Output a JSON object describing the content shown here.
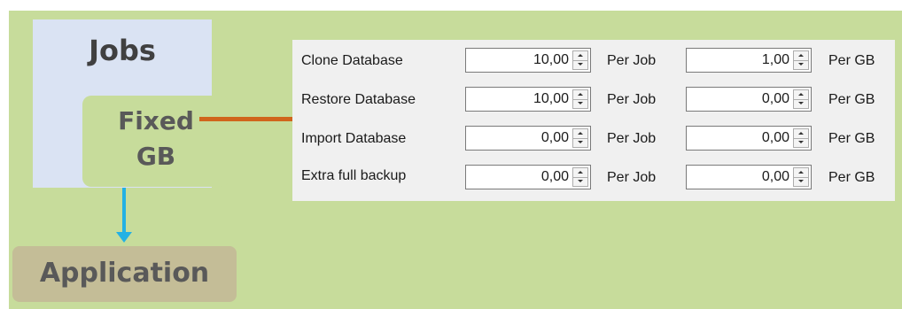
{
  "diagram": {
    "jobs_title": "Jobs",
    "fixed_line1": "Fixed",
    "fixed_line2": "GB",
    "application_label": "Application",
    "colors": {
      "background": "#c7dc9b",
      "jobs_box": "#dae3f3",
      "application_box": "#c4bd97",
      "connector": "#d0651c",
      "arrow": "#23b1e4"
    }
  },
  "form": {
    "rows": [
      {
        "label": "Clone Database",
        "per_job_value": "10,00",
        "per_job_unit": "Per Job",
        "per_gb_value": "1,00",
        "per_gb_unit": "Per GB"
      },
      {
        "label": "Restore Database",
        "per_job_value": "10,00",
        "per_job_unit": "Per Job",
        "per_gb_value": "0,00",
        "per_gb_unit": "Per GB"
      },
      {
        "label": "Import Database",
        "per_job_value": "0,00",
        "per_job_unit": "Per Job",
        "per_gb_value": "0,00",
        "per_gb_unit": "Per GB"
      },
      {
        "label": "Extra full backup",
        "per_job_value": "0,00",
        "per_job_unit": "Per Job",
        "per_gb_value": "0,00",
        "per_gb_unit": "Per GB"
      }
    ]
  }
}
